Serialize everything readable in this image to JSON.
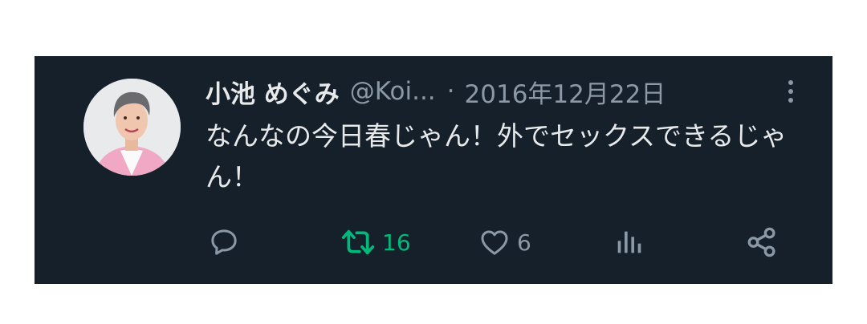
{
  "tweet": {
    "display_name": "小池 めぐみ",
    "handle": "@Koi...",
    "separator": "·",
    "date": "2016年12月22日",
    "text": "なんなの今日春じゃん！外でセックスできるじゃん！"
  },
  "actions": {
    "reply": {
      "icon": "speech-bubble-icon",
      "count": ""
    },
    "retweet": {
      "icon": "retweet-icon",
      "count": "16",
      "color": "#00ba7c"
    },
    "like": {
      "icon": "heart-icon",
      "count": "6"
    },
    "views": {
      "icon": "bar-chart-icon",
      "count": ""
    },
    "share": {
      "icon": "share-icon",
      "count": ""
    }
  },
  "colors": {
    "card_background": "#15202b",
    "primary_text": "#e7e9ea",
    "secondary_text": "#8b98a5",
    "retweet_green": "#00ba7c"
  }
}
